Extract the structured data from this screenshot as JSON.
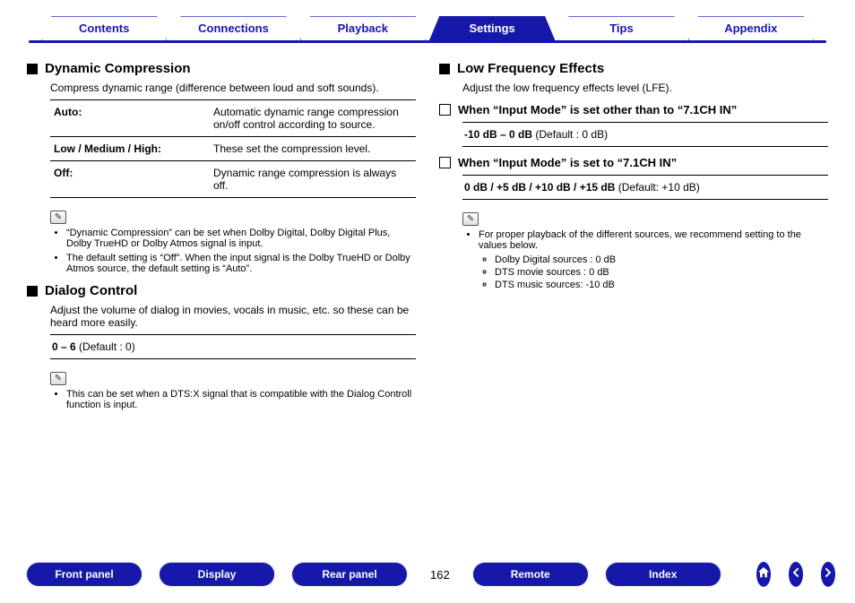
{
  "tabs": {
    "items": [
      "Contents",
      "Connections",
      "Playback",
      "Settings",
      "Tips",
      "Appendix"
    ],
    "active_index": 3
  },
  "left": {
    "dyn": {
      "title": "Dynamic Compression",
      "intro": "Compress dynamic range (difference between loud and soft sounds).",
      "rows": [
        {
          "k": "Auto:",
          "v": "Automatic dynamic range compression on/off control according to source."
        },
        {
          "k": "Low / Medium / High:",
          "v": "These set the compression level."
        },
        {
          "k": "Off:",
          "v": "Dynamic range compression is always off."
        }
      ],
      "notes": [
        "“Dynamic Compression” can be set when Dolby Digital, Dolby Digital Plus, Dolby TrueHD or Dolby Atmos signal is input.",
        "The default setting is “Off”. When the input signal is the Dolby TrueHD or Dolby Atmos source, the default setting is “Auto”."
      ]
    },
    "dialog": {
      "title": "Dialog Control",
      "intro": "Adjust the volume of dialog in movies, vocals in music, etc. so these can be heard more easily.",
      "range_bold": "0 – 6",
      "range_rest": " (Default : 0)",
      "notes": [
        "This can be set when a DTS:X signal that is compatible with the Dialog Controll function is input."
      ]
    }
  },
  "right": {
    "lfe": {
      "title": "Low Frequency Effects",
      "intro": "Adjust the low frequency effects level (LFE).",
      "case1": {
        "title": "When “Input Mode” is set other than to “7.1CH IN”",
        "range_bold": "-10 dB – 0 dB",
        "range_rest": " (Default : 0 dB)"
      },
      "case2": {
        "title": "When “Input Mode” is set to “7.1CH IN”",
        "range_bold": "0 dB / +5 dB / +10 dB / +15 dB",
        "range_rest": " (Default: +10 dB)"
      },
      "note_lead": "For proper playback of the different sources, we recommend setting to the values below.",
      "note_items": [
        "Dolby Digital sources : 0 dB",
        "DTS movie sources : 0 dB",
        "DTS music sources: -10 dB"
      ]
    }
  },
  "bottom": {
    "buttons_left": [
      "Front panel",
      "Display",
      "Rear panel"
    ],
    "page": "162",
    "buttons_right": [
      "Remote",
      "Index"
    ]
  }
}
